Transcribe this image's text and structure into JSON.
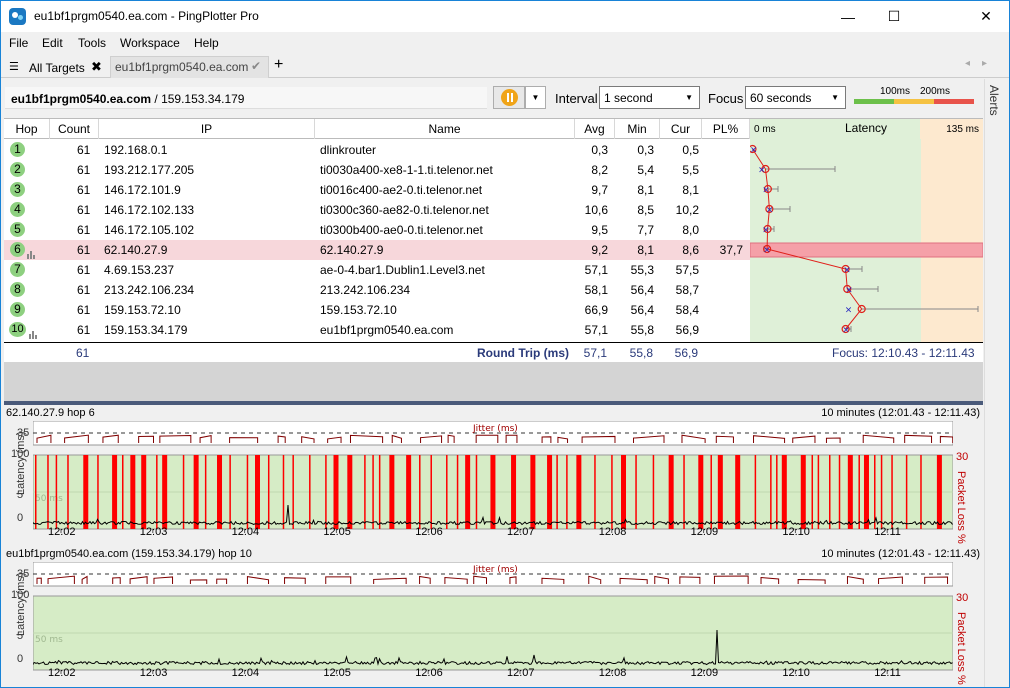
{
  "window": {
    "title": "eu1bf1prgm0540.ea.com - PingPlotter Pro",
    "minimize": "—",
    "maximize": "☐",
    "close": "✕"
  },
  "menu": [
    "File",
    "Edit",
    "Tools",
    "Workspace",
    "Help"
  ],
  "tabs": {
    "all_targets": "All Targets",
    "active": "eu1bf1prgm0540.ea.com",
    "add": "+"
  },
  "toolbar": {
    "target_host": "eu1bf1prgm0540.ea.com",
    "target_ip": " / 159.153.34.179",
    "interval_label": "Interval",
    "interval_value": "1 second",
    "focus_label": "Focus",
    "focus_value": "60 seconds",
    "scale_100": "100ms",
    "scale_200": "200ms",
    "alerts_label": "Alerts"
  },
  "grid": {
    "headers": [
      "Hop",
      "Count",
      "IP",
      "Name",
      "Avg",
      "Min",
      "Cur",
      "PL%"
    ],
    "latency_header": "Latency",
    "latency_min": "0 ms",
    "latency_max": "135 ms",
    "rows": [
      {
        "hop": "1",
        "count": "61",
        "ip": "192.168.0.1",
        "name": "dlinkrouter",
        "avg": "0,3",
        "min": "0,3",
        "cur": "0,5",
        "pl": ""
      },
      {
        "hop": "2",
        "count": "61",
        "ip": "193.212.177.205",
        "name": "ti0030a400-xe8-1-1.ti.telenor.net",
        "avg": "8,2",
        "min": "5,4",
        "cur": "5,5",
        "pl": ""
      },
      {
        "hop": "3",
        "count": "61",
        "ip": "146.172.101.9",
        "name": "ti0016c400-ae2-0.ti.telenor.net",
        "avg": "9,7",
        "min": "8,1",
        "cur": "8,1",
        "pl": ""
      },
      {
        "hop": "4",
        "count": "61",
        "ip": "146.172.102.133",
        "name": "ti0300c360-ae82-0.ti.telenor.net",
        "avg": "10,6",
        "min": "8,5",
        "cur": "10,2",
        "pl": ""
      },
      {
        "hop": "5",
        "count": "61",
        "ip": "146.172.105.102",
        "name": "ti0300b400-ae0-0.ti.telenor.net",
        "avg": "9,5",
        "min": "7,7",
        "cur": "8,0",
        "pl": ""
      },
      {
        "hop": "6",
        "count": "61",
        "ip": "62.140.27.9",
        "name": "62.140.27.9",
        "avg": "9,2",
        "min": "8,1",
        "cur": "8,6",
        "pl": "37,7"
      },
      {
        "hop": "7",
        "count": "61",
        "ip": "4.69.153.237",
        "name": "ae-0-4.bar1.Dublin1.Level3.net",
        "avg": "57,1",
        "min": "55,3",
        "cur": "57,5",
        "pl": ""
      },
      {
        "hop": "8",
        "count": "61",
        "ip": "213.242.106.234",
        "name": "213.242.106.234",
        "avg": "58,1",
        "min": "56,4",
        "cur": "58,7",
        "pl": ""
      },
      {
        "hop": "9",
        "count": "61",
        "ip": "159.153.72.10",
        "name": "159.153.72.10",
        "avg": "66,9",
        "min": "56,4",
        "cur": "58,4",
        "pl": ""
      },
      {
        "hop": "10",
        "count": "61",
        "ip": "159.153.34.179",
        "name": "eu1bf1prgm0540.ea.com",
        "avg": "57,1",
        "min": "55,8",
        "cur": "56,9",
        "pl": ""
      }
    ],
    "round_trip": {
      "count": "61",
      "label": "Round Trip (ms)",
      "avg": "57,1",
      "min": "55,8",
      "cur": "56,9",
      "focus": "Focus: 12:10.43 - 12:11.43"
    }
  },
  "panels": [
    {
      "title": "62.140.27.9 hop 6",
      "range": "10 minutes (12:01.43 - 12:11.43)",
      "jitter_label": "Jitter (ms)",
      "jitter_max": "35",
      "y_max": "100",
      "y_mid": "5",
      "y_min": "0",
      "y_label": "Latency (ms)",
      "loss_max": "30",
      "loss_label": "Packet Loss %",
      "faint_label": "50 ms"
    },
    {
      "title": "eu1bf1prgm0540.ea.com (159.153.34.179) hop 10",
      "range": "10 minutes (12:01.43 - 12:11.43)",
      "jitter_label": "Jitter (ms)",
      "jitter_max": "35",
      "y_max": "100",
      "y_mid": "5",
      "y_min": "0",
      "y_label": "Latency (ms)",
      "loss_max": "30",
      "loss_label": "Packet Loss %",
      "faint_label": "50 ms"
    }
  ],
  "time_ticks": [
    "12:02",
    "12:03",
    "12:04",
    "12:05",
    "12:06",
    "12:07",
    "12:08",
    "12:09",
    "12:10",
    "12:11"
  ],
  "colors": {
    "good": "#dff0d8",
    "warn": "#fde9cf",
    "bad": "#f5a0a8",
    "loss": "#ff0000",
    "hop_green": "#8ed080",
    "accent": "#1883d7"
  }
}
